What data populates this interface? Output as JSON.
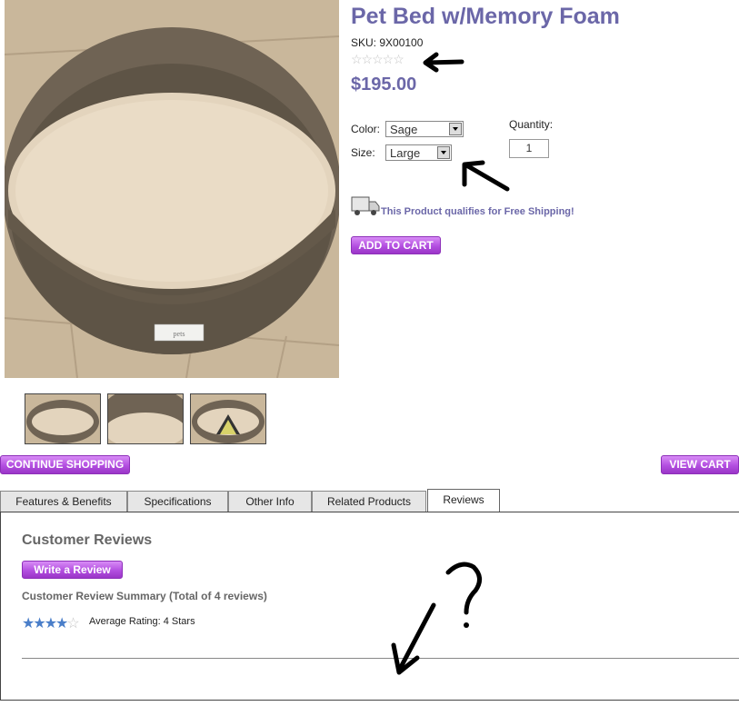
{
  "product": {
    "title": "Pet Bed w/Memory Foam",
    "sku": "SKU: 9X00100",
    "star_rating_empty": "☆☆☆☆☆",
    "price": "$195.00",
    "color_label": "Color:",
    "color_value": "Sage",
    "size_label": "Size:",
    "size_value": "Large",
    "quantity_label": "Quantity:",
    "quantity_value": "1",
    "shipping_text": "This Product qualifies for Free Shipping!",
    "add_to_cart": "ADD TO CART"
  },
  "nav": {
    "continue_shopping": "CONTINUE SHOPPING",
    "view_cart": "VIEW CART"
  },
  "tabs": [
    {
      "label": "Features & Benefits"
    },
    {
      "label": "Specifications"
    },
    {
      "label": "Other Info"
    },
    {
      "label": "Related Products"
    },
    {
      "label": "Reviews"
    }
  ],
  "reviews": {
    "title": "Customer Reviews",
    "write_review": "Write a Review",
    "summary": "Customer Review Summary (Total of 4 reviews)",
    "average_rating": "Average Rating: 4 Stars",
    "rating_value": 4,
    "rating_max": 5
  },
  "colors": {
    "accent_text": "#6b67a8",
    "button_purple": "#b34fe0",
    "star_blue": "#4a7ec9"
  }
}
